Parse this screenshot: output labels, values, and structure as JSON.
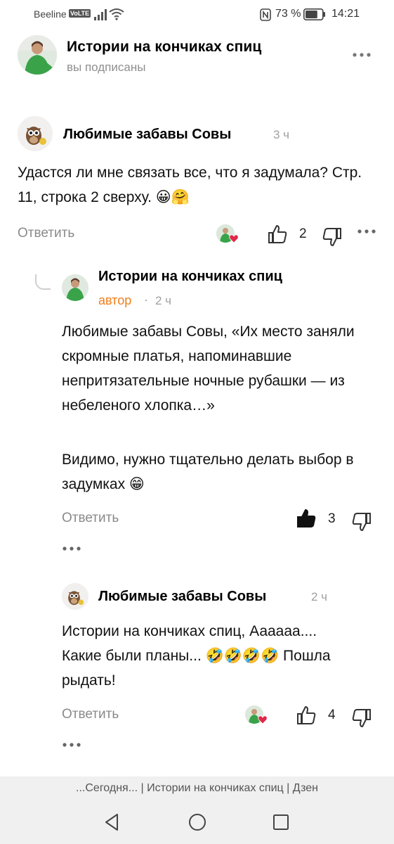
{
  "status_bar": {
    "carrier": "Beeline",
    "network_badge": "VoLTE",
    "battery_percent": "73 %",
    "time": "14:21",
    "battery_level": 0.73
  },
  "channel": {
    "name": "Истории на кончиках спиц",
    "subtitle": "вы подписаны",
    "more_icon": "more-dots-icon"
  },
  "comments": [
    {
      "author": "Любимые забавы Совы",
      "time": "3 ч",
      "text": "Удастся ли мне связать все, что я задумала? Стр. 11, строка 2 сверху. 😀🤗",
      "reply_label": "Ответить",
      "likes": "2"
    },
    {
      "author": "Истории на кончиках спиц",
      "tag": "автор",
      "separator": "·",
      "time": "2 ч",
      "text_p1": "Любимые забавы Совы, «Их место заняли скромные платья, напоминавшие непритязательные ночные рубашки — из небеленого хлопка…»",
      "text_p2": "Видимо, нужно тщательно делать выбор в задумках 😁",
      "reply_label": "Ответить",
      "likes": "3"
    },
    {
      "author": "Любимые забавы Совы",
      "time": "2 ч",
      "text": "Истории на кончиках спиц, Аааааа.... Какие были планы... 🤣🤣🤣🤣 Пошла рыдать!",
      "reply_label": "Ответить",
      "likes": "4"
    }
  ],
  "tab_title": "...Сегодня... | Истории на кончиках спиц | Дзен",
  "colors": {
    "author_tag": "#f07d1a",
    "muted_text": "#8a8a8a",
    "heart": "#e0284a"
  }
}
